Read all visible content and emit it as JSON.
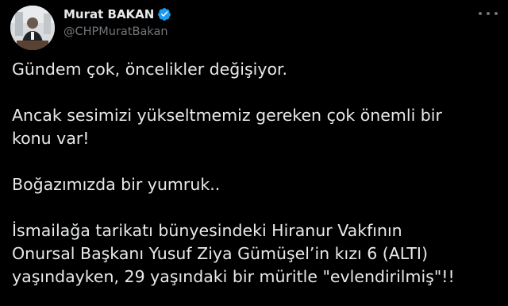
{
  "author": {
    "display_name": "Murat BAKAN",
    "handle": "@CHPMuratBakan",
    "verified": true
  },
  "colors": {
    "background": "#000000",
    "text": "#e7e9ea",
    "secondary_text": "#71767b",
    "verified_badge": "#1d9bf0"
  },
  "tweet": {
    "lines": [
      "Gündem çok, öncelikler değişiyor.",
      "Ancak sesimizi yükseltmemiz gereken çok önemli bir",
      "konu var!",
      "Boğazımızda bir yumruk..",
      "İsmailağa tarikatı bünyesindeki Hiranur Vakfının",
      "Onursal Başkanı Yusuf Ziya Gümüşel’in kızı 6 (ALTI)",
      "yaşındayken, 29 yaşındaki bir müritle \"evlendirilmiş\"!!"
    ]
  }
}
